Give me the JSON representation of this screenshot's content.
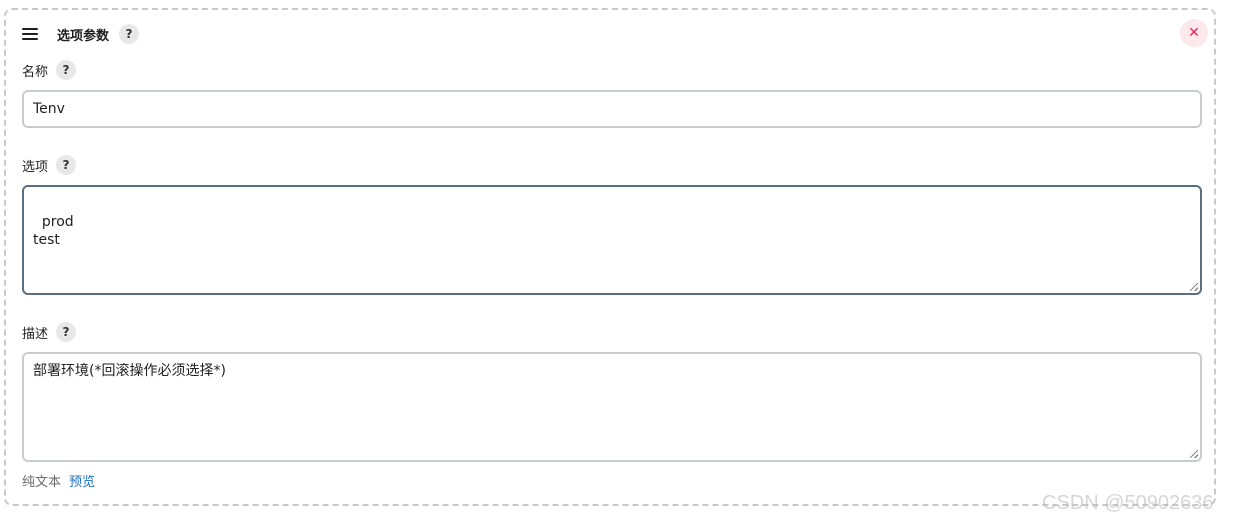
{
  "header": {
    "title": "选项参数",
    "help_label": "?",
    "close_label": "✕"
  },
  "fields": {
    "name": {
      "label": "名称",
      "help_label": "?",
      "value": "Tenv"
    },
    "choices": {
      "label": "选项",
      "help_label": "?",
      "value": "prod\ntest"
    },
    "description": {
      "label": "描述",
      "help_label": "?",
      "value": "部署环境(*回滚操作必须选择*)"
    }
  },
  "format": {
    "plain_text_label": "纯文本",
    "preview_label": "预览"
  },
  "watermark": "CSDN @50902636",
  "colors": {
    "close_bg": "#fde8ec",
    "close_fg": "#e0245e",
    "link": "#1a6fc7",
    "focused_border": "#5c6f80"
  }
}
